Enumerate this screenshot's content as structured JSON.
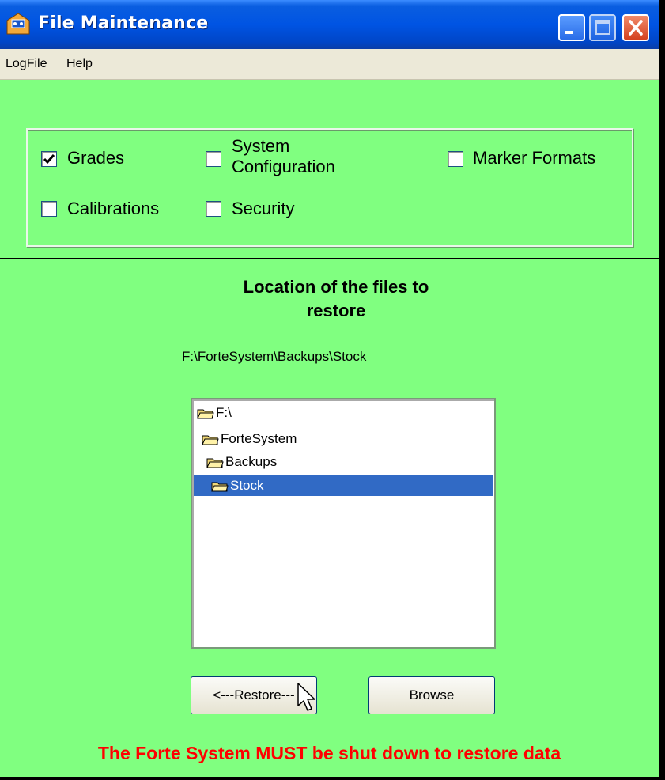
{
  "window": {
    "title": "File Maintenance"
  },
  "menu": {
    "items": [
      "LogFile",
      "Help"
    ]
  },
  "restore_options": {
    "grades": {
      "label": "Grades",
      "checked": true
    },
    "system_configuration": {
      "label_line1": "System",
      "label_line2": "Configuration",
      "checked": false
    },
    "marker_formats": {
      "label": "Marker Formats",
      "checked": false
    },
    "calibrations": {
      "label": "Calibrations",
      "checked": false
    },
    "security": {
      "label": "Security",
      "checked": false
    }
  },
  "location": {
    "heading_line1": "Location of the files to",
    "heading_line2": "restore",
    "path": "F:\\ForteSystem\\Backups\\Stock"
  },
  "tree": {
    "items": [
      {
        "label": "F:\\",
        "selected": false
      },
      {
        "label": "ForteSystem",
        "selected": false
      },
      {
        "label": "Backups",
        "selected": false
      },
      {
        "label": "Stock",
        "selected": true
      }
    ]
  },
  "buttons": {
    "restore": "<---Restore---",
    "browse": "Browse"
  },
  "warning": "The Forte System MUST be shut down to restore data",
  "colors": {
    "background": "#80ff80",
    "selection": "#316ac5",
    "warning": "#ff0000",
    "titlebar": "#0054e3"
  }
}
